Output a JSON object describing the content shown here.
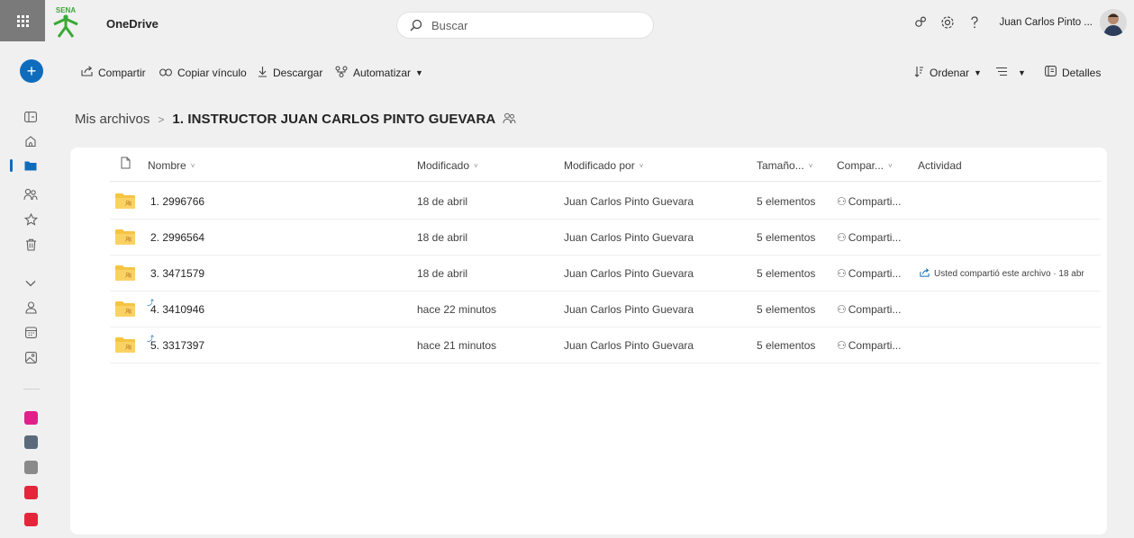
{
  "app": {
    "name": "OneDrive",
    "logo_text": "SENA"
  },
  "search": {
    "placeholder": "Buscar"
  },
  "user": {
    "name": "Juan Carlos Pinto ..."
  },
  "icons": {
    "waffle": "app-launcher-icon",
    "search": "search-icon",
    "premium": "diamond-icon",
    "settings": "gear-icon",
    "help": "question-icon",
    "new": "plus-icon"
  },
  "colors": {
    "accent": "#0f6cbd",
    "folder": "#f6c443",
    "background": "#f0f0f0"
  },
  "commands": {
    "share": "Compartir",
    "copy_link": "Copiar vínculo",
    "download": "Descargar",
    "automate": "Automatizar",
    "sort": "Ordenar",
    "details": "Detalles"
  },
  "breadcrumb": {
    "root": "Mis archivos",
    "separator": ">",
    "current": "1. INSTRUCTOR JUAN CARLOS PINTO GUEVARA"
  },
  "columns": {
    "name": "Nombre",
    "modified": "Modificado",
    "modified_by": "Modificado por",
    "size": "Tamaño...",
    "sharing": "Compar...",
    "activity": "Actividad"
  },
  "files": [
    {
      "name": "1. 2996766",
      "modified": "18 de abril",
      "modified_by": "Juan Carlos Pinto Guevara",
      "size": "5 elementos",
      "sharing": "Comparti...",
      "activity": ""
    },
    {
      "name": "2. 2996564",
      "modified": "18 de abril",
      "modified_by": "Juan Carlos Pinto Guevara",
      "size": "5 elementos",
      "sharing": "Comparti...",
      "activity": ""
    },
    {
      "name": "3. 3471579",
      "modified": "18 de abril",
      "modified_by": "Juan Carlos Pinto Guevara",
      "size": "5 elementos",
      "sharing": "Comparti...",
      "activity": "Usted compartió este archivo · 18 abr"
    },
    {
      "name": "4. 3410946",
      "modified": "hace 22 minutos",
      "modified_by": "Juan Carlos Pinto Guevara",
      "size": "5 elementos",
      "sharing": "Comparti...",
      "activity": ""
    },
    {
      "name": "5. 3317397",
      "modified": "hace 21 minutos",
      "modified_by": "Juan Carlos Pinto Guevara",
      "size": "5 elementos",
      "sharing": "Comparti...",
      "activity": ""
    }
  ],
  "rail_apps": [
    {
      "name": "app-1",
      "color": "#e0218a"
    },
    {
      "name": "app-2",
      "color": "#5a6a7a"
    },
    {
      "name": "app-3",
      "color": "#8a8a8a"
    },
    {
      "name": "app-4",
      "color": "#e4263b"
    },
    {
      "name": "app-5",
      "color": "#e4263b"
    }
  ]
}
